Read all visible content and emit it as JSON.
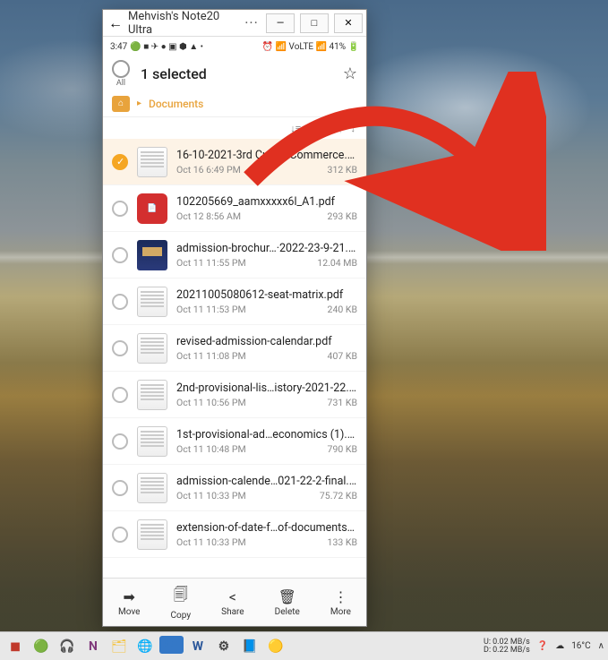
{
  "window": {
    "title": "Mehvish's Note20 Ultra",
    "back_glyph": "←",
    "more_glyph": "···",
    "min_glyph": "—",
    "max_glyph": "□",
    "close_glyph": "✕"
  },
  "statusbar": {
    "time": "3:47",
    "left_icons": "🟢 ■ ✈ ● ▣ ⬢ ▲ •",
    "right_icons": "⏰ 📶 VoLTE 📶 41% 🔋"
  },
  "selection": {
    "all_label": "All",
    "title": "1 selected",
    "star_glyph": "☆"
  },
  "breadcrumb": {
    "home_glyph": "⌂",
    "sep": "▸",
    "current": "Documents"
  },
  "sortbar": {
    "sort_glyph": "↓≡",
    "sort_label": "Date",
    "order_glyph": "↓"
  },
  "files": [
    {
      "name": "16-10-2021-3rd Cu…rtsCommerce.pdf",
      "date": "Oct 16 6:49 PM",
      "size": "312 KB",
      "selected": true,
      "thumb": "doc"
    },
    {
      "name": "102205669_aamxxxxx6l_A1.pdf",
      "date": "Oct 12 8:56 AM",
      "size": "293 KB",
      "selected": false,
      "thumb": "pdf"
    },
    {
      "name": "admission-brochur…·2022-23-9-21.pdf",
      "date": "Oct 11 11:55 PM",
      "size": "12.04 MB",
      "selected": false,
      "thumb": "brochure"
    },
    {
      "name": "20211005080612-seat-matrix.pdf",
      "date": "Oct 11 11:53 PM",
      "size": "240 KB",
      "selected": false,
      "thumb": "doc"
    },
    {
      "name": "revised-admission-calendar.pdf",
      "date": "Oct 11 11:08 PM",
      "size": "407 KB",
      "selected": false,
      "thumb": "doc"
    },
    {
      "name": "2nd-provisional-lis…istory-2021-22.pdf",
      "date": "Oct 11 10:56 PM",
      "size": "731 KB",
      "selected": false,
      "thumb": "doc"
    },
    {
      "name": "1st-provisional-ad…economics (1).pdf",
      "date": "Oct 11 10:48 PM",
      "size": "790 KB",
      "selected": false,
      "thumb": "doc"
    },
    {
      "name": "admission-calende…021-22-2-final.pdf",
      "date": "Oct 11 10:33 PM",
      "size": "75.72 KB",
      "selected": false,
      "thumb": "doc"
    },
    {
      "name": "extension-of-date-f…of-documents.pdf",
      "date": "Oct 11 10:33 PM",
      "size": "133 KB",
      "selected": false,
      "thumb": "doc"
    }
  ],
  "actions": {
    "move": {
      "label": "Move",
      "glyph": "➡"
    },
    "copy": {
      "label": "Copy",
      "glyph": "🗐"
    },
    "share": {
      "label": "Share",
      "glyph": "<"
    },
    "delete": {
      "label": "Delete",
      "glyph": "🗑"
    },
    "more": {
      "label": "More",
      "glyph": "⋮"
    }
  },
  "taskbar": {
    "icons": [
      {
        "name": "app-1",
        "glyph": "◼",
        "color": "#c0392b"
      },
      {
        "name": "whatsapp-icon",
        "glyph": "🟢",
        "color": "#25d366"
      },
      {
        "name": "app-3",
        "glyph": "🎧",
        "color": "#888"
      },
      {
        "name": "onenote-icon",
        "glyph": "N",
        "color": "#80397b"
      },
      {
        "name": "explorer-icon",
        "glyph": "🗂",
        "color": "#f5c542"
      },
      {
        "name": "chrome-icon",
        "glyph": "🌐",
        "color": "#4285f4"
      },
      {
        "name": "mail-icon",
        "glyph": "99+",
        "color": "#3478c7",
        "pill": true
      },
      {
        "name": "word-icon",
        "glyph": "W",
        "color": "#2b579a"
      },
      {
        "name": "settings-icon",
        "glyph": "⚙",
        "color": "#444"
      },
      {
        "name": "app-10",
        "glyph": "📘",
        "color": "#3aa"
      },
      {
        "name": "app-11",
        "glyph": "🟡",
        "color": "#555"
      }
    ],
    "net_up": "U:",
    "net_dn": "D:",
    "speed_up": "0.02 MB/s",
    "speed_dn": "0.22 MB/s",
    "help_glyph": "❓",
    "weather_glyph": "☁",
    "temp": "16°C",
    "expand_glyph": "∧"
  }
}
